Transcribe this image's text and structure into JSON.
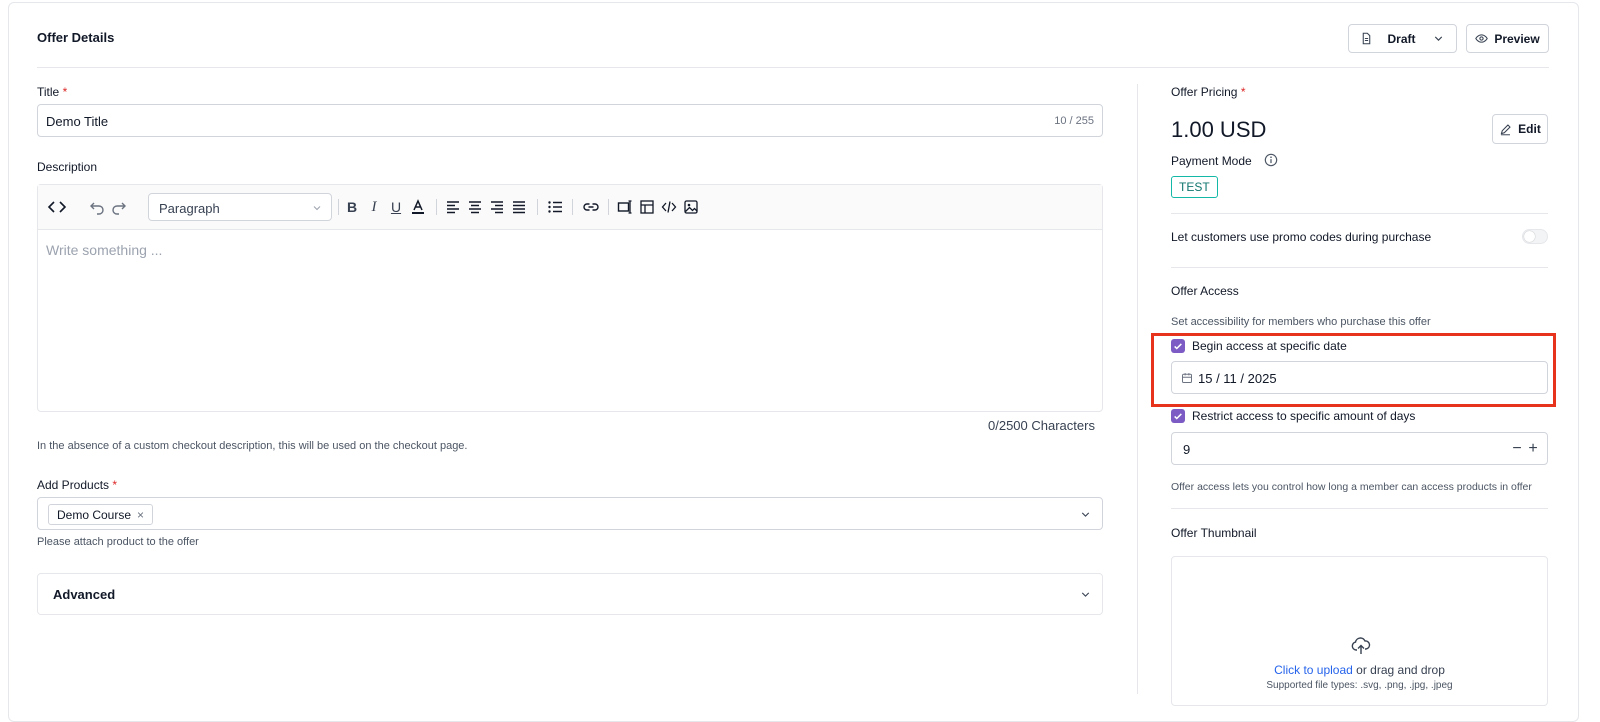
{
  "header": {
    "title": "Offer Details",
    "draft_label": "Draft",
    "preview_label": "Preview"
  },
  "form": {
    "title_label": "Title",
    "required_mark": "*",
    "title_value": "Demo Title",
    "title_count": "10 / 255",
    "description_label": "Description",
    "editor": {
      "block_format": "Paragraph",
      "placeholder": "Write something ...",
      "char_count": "0/2500 Characters"
    },
    "description_hint": "In the absence of a custom checkout description, this will be used on the checkout page.",
    "products_label": "Add Products",
    "product_chip": "Demo Course",
    "chip_remove": "×",
    "products_hint": "Please attach product to the offer",
    "advanced_label": "Advanced"
  },
  "sidebar": {
    "pricing_label": "Offer Pricing",
    "price": "1.00 USD",
    "edit_label": "Edit",
    "payment_mode_label": "Payment Mode",
    "payment_mode_badge": "TEST",
    "promo_label": "Let customers use promo codes during purchase",
    "promo_enabled": false,
    "access_title": "Offer Access",
    "access_subtitle": "Set accessibility for members who purchase this offer",
    "begin_access_label": "Begin access at specific date",
    "begin_access_checked": true,
    "begin_date": "15 / 11 / 2025",
    "restrict_label": "Restrict access to specific amount of days",
    "restrict_checked": true,
    "days_value": "9",
    "minus": "−",
    "plus": "+",
    "access_hint": "Offer access lets you control how long a member can access products in offer",
    "thumbnail_label": "Offer Thumbnail",
    "upload_link": "Click to upload",
    "upload_rest": " or drag and drop",
    "upload_types": "Supported file types: .svg, .png, .jpg, .jpeg"
  },
  "colors": {
    "accent": "#7c5cc4",
    "required": "#dc2626",
    "highlight": "#e8331c",
    "badge": "#14b8a6",
    "link": "#2563eb"
  }
}
